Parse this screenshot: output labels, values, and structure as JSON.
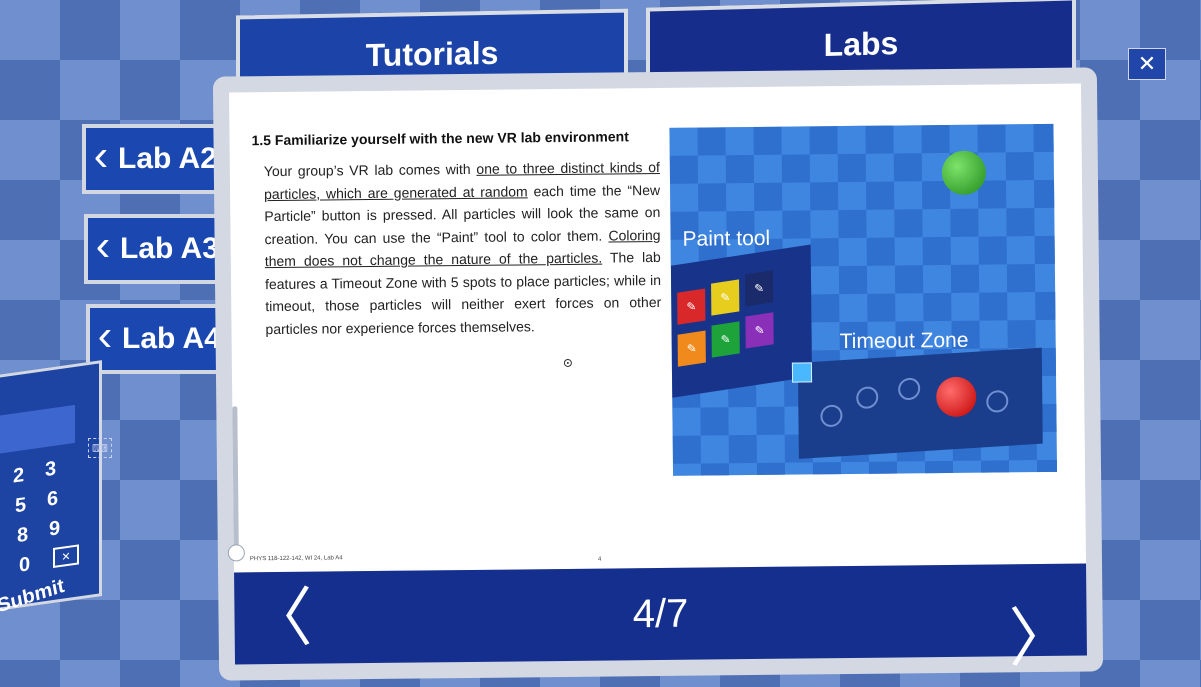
{
  "tabs": {
    "tutorials": "Tutorials",
    "labs": "Labs"
  },
  "close_icon": "close-icon",
  "close_glyph": "✕",
  "lab_buttons": [
    {
      "label": "Lab A2",
      "icon": "chevron-left-icon",
      "glyph": "‹"
    },
    {
      "label": "Lab A3",
      "icon": "chevron-left-icon",
      "glyph": "‹"
    },
    {
      "label": "Lab A4",
      "icon": "chevron-left-icon",
      "glyph": "‹"
    }
  ],
  "keypad": {
    "keys": [
      "2",
      "3",
      "5",
      "6",
      "8",
      "9",
      "0"
    ],
    "backspace_glyph": "✕",
    "submit": "Submit"
  },
  "document": {
    "heading": "1.5 Familiarize yourself with the new VR lab environment",
    "body": {
      "p1": "Your group’s VR lab comes with ",
      "u1": "one to three distinct kinds of particles, which are generated at random",
      "p2": " each time the “New Particle” button is pressed. All particles will look the same on creation. You can use the “Paint” tool to color them. ",
      "u2": "Coloring them does not change the nature of the particles.",
      "p3": " The lab features a Timeout Zone with 5 spots to place particles; while in timeout, those particles will neither exert forces on other particles nor experience forces themselves."
    },
    "figure_labels": {
      "paint_tool": "Paint tool",
      "timeout_zone": "Timeout Zone"
    },
    "footer": "PHYS 118-122-142, WI 24, Lab A4",
    "page_number": "4"
  },
  "pager": {
    "current": "4/7",
    "prev_icon": "chevron-left-icon",
    "next_icon": "chevron-right-icon",
    "prev_glyph": "〈",
    "next_glyph": "〉"
  },
  "colors": {
    "panel_blue": "#1c44a8",
    "nav_blue": "#142f8e",
    "frame_gray": "#d3d8e3"
  }
}
